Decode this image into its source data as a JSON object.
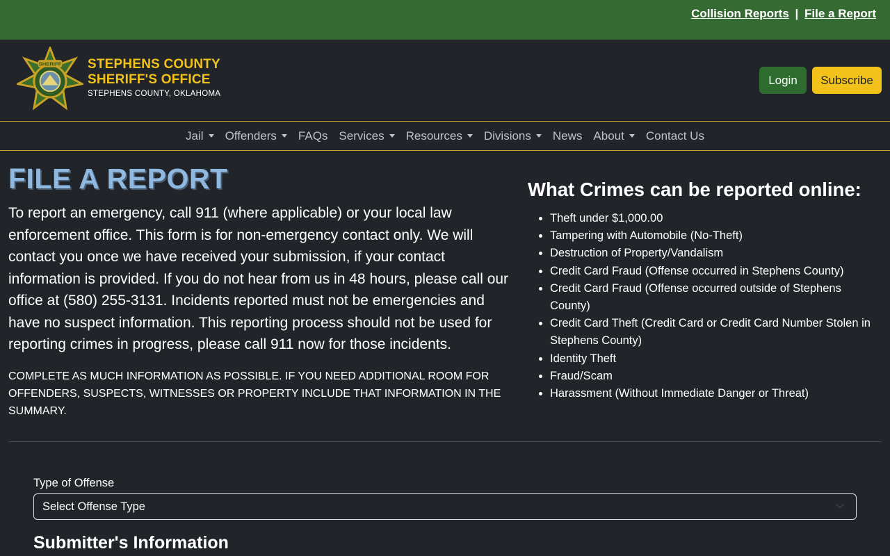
{
  "topbar": {
    "collision_reports": "Collision Reports",
    "separator": "|",
    "file_report": "File a Report"
  },
  "header": {
    "brand_line1": "STEPHENS COUNTY",
    "brand_line2": "SHERIFF'S OFFICE",
    "brand_line3": "STEPHENS COUNTY, OKLAHOMA",
    "login": "Login",
    "subscribe": "Subscribe",
    "badge_text": "SHERIFF"
  },
  "nav": {
    "items": [
      {
        "label": "Jail",
        "dropdown": true
      },
      {
        "label": "Offenders",
        "dropdown": true
      },
      {
        "label": "FAQs",
        "dropdown": false
      },
      {
        "label": "Services",
        "dropdown": true
      },
      {
        "label": "Resources",
        "dropdown": true
      },
      {
        "label": "Divisions",
        "dropdown": true
      },
      {
        "label": "News",
        "dropdown": false
      },
      {
        "label": "About",
        "dropdown": true
      },
      {
        "label": "Contact Us",
        "dropdown": false
      }
    ]
  },
  "main": {
    "title": "FILE A REPORT",
    "intro": "To report an emergency, call 911 (where applicable) or your local law enforcement office. This form is for non-emergency contact only. We will contact you once we have received your submission, if your contact information is provided. If you do not hear from us in 48 hours, please call our office at (580) 255-3131. Incidents reported must not be emergencies and have no suspect information. This reporting process should not be used for reporting crimes in progress, please call 911 now for those incidents.",
    "notice": "COMPLETE AS MUCH INFORMATION AS POSSIBLE. IF YOU NEED ADDITIONAL ROOM FOR OFFENDERS, SUSPECTS, WITNESSES OR PROPERTY INCLUDE THAT INFORMATION IN THE SUMMARY."
  },
  "crimes": {
    "title": "What Crimes can be reported online:",
    "items": [
      "Theft under $1,000.00",
      "Tampering with Automobile (No-Theft)",
      "Destruction of Property/Vandalism",
      "Credit Card Fraud (Offense occurred in Stephens County)",
      "Credit Card Fraud (Offense occurred outside of Stephens County)",
      "Credit Card Theft (Credit Card or Credit Card Number Stolen in Stephens County)",
      "Identity Theft",
      "Fraud/Scam",
      "Harassment (Without Immediate Danger or Threat)"
    ]
  },
  "form": {
    "offense_label": "Type of Offense",
    "offense_selected": "Select Offense Type",
    "submitter_heading": "Submitter's Information"
  },
  "colors": {
    "topbar": "#356b32",
    "accent_gold": "#f2c21b",
    "title_blue": "#8fb9e0",
    "background": "#212529"
  }
}
